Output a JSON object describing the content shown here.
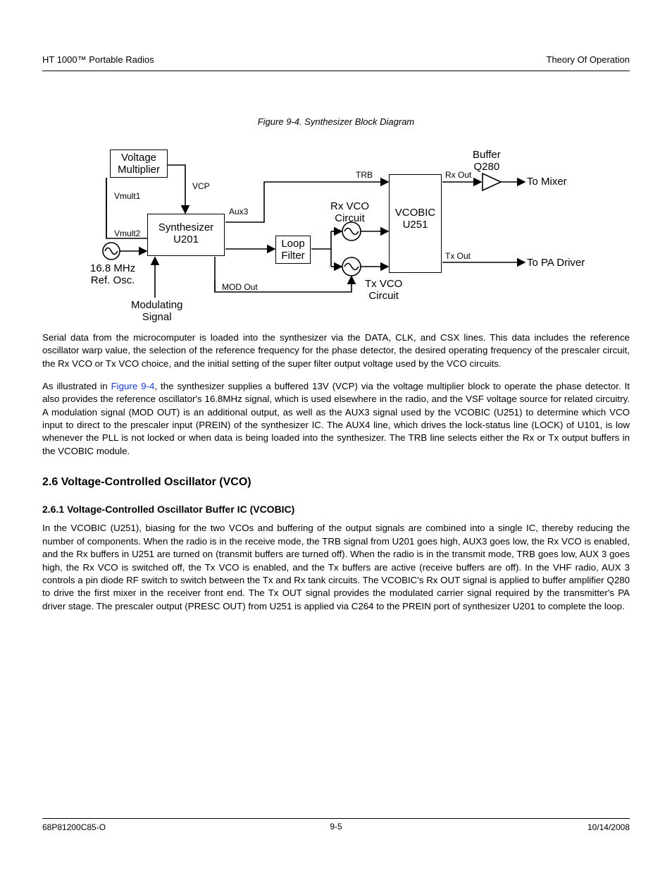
{
  "header": {
    "left": "HT 1000™ Portable Radios",
    "right": "Theory Of Operation"
  },
  "footer": {
    "left": "68P81200C85-O",
    "right": "10/14/2008",
    "center": "9-5"
  },
  "figure": {
    "title": "Figure 9-4. Synthesizer Block Diagram",
    "ref": "Figure 9-4",
    "blocks": {
      "voltage_multiplier": "Voltage\nMultiplier",
      "synthesizer": "Synthesizer\nU201",
      "loop_filter": "Loop\nFilter",
      "vcobic": "VCOBIC\nU251",
      "rx_vco": "Rx VCO\nCircuit",
      "tx_vco": "Tx VCO\nCircuit",
      "buffer": "Buffer\nQ280"
    },
    "signals": {
      "vcp": "VCP",
      "aux3": "Aux3",
      "trb": "TRB",
      "rx_out": "Rx Out",
      "tx_out": "Tx Out",
      "to_mixer": "To Mixer",
      "to_pa": "To PA Driver",
      "vmult1": "Vmult1",
      "vmult2": "Vmult2",
      "ref_osc": "16.8 MHz\nRef. Osc.",
      "mod_out": "MOD Out",
      "modulating": "Modulating\nSignal"
    }
  },
  "text": {
    "p1": "Serial data from the microcomputer is loaded into the synthesizer via the DATA, CLK, and CSX lines. This data includes the reference oscillator warp value, the selection of the reference frequency for the phase detector, the desired operating frequency of the prescaler circuit, the Rx VCO or Tx VCO choice, and the initial setting of the super filter output voltage used by the VCO circuits.",
    "p2_a": "As illustrated in ",
    "p2_b": ", the synthesizer supplies a buffered 13V (VCP) via the voltage multiplier block to operate the phase detector. It also provides the reference oscillator's 16.8MHz signal, which is used elsewhere in the radio, and the VSF voltage source for related circuitry. A modulation signal (MOD OUT) is an additional output, as well as the AUX3 signal used by the VCOBIC (U251) to determine which VCO input to direct to the prescaler input (PREIN) of the synthesizer IC. The AUX4 line, which drives the lock-status line (LOCK) of U101, is low whenever the PLL is not locked or when data is being loaded into the synthesizer. The TRB line selects either the Rx or Tx output buffers in the VCOBIC module.",
    "h2": "2.6 Voltage-Controlled Oscillator (VCO)",
    "h3": "2.6.1 Voltage-Controlled Oscillator Buffer IC (VCOBIC)",
    "p3": "In the VCOBIC (U251), biasing for the two VCOs and buffering of the output signals are combined into a single IC, thereby reducing the number of components. When the radio is in the receive mode, the TRB signal from U201 goes high, AUX3 goes low, the Rx VCO is enabled, and the Rx buffers in U251 are turned on (transmit buffers are turned off). When the radio is in the transmit mode, TRB goes low, AUX 3 goes high, the Rx VCO is switched off, the Tx VCO is enabled, and the Tx buffers are active (receive buffers are off). In the VHF radio, AUX 3 controls a pin diode RF switch to switch between the Tx and Rx tank circuits. The VCOBIC's Rx OUT signal is applied to buffer amplifier Q280 to drive the first mixer in the receiver front end. The Tx OUT signal provides the modulated carrier signal required by the transmitter's PA driver stage. The prescaler output (PRESC OUT) from U251 is applied via C264 to the PREIN port of synthesizer U201 to complete the loop."
  }
}
